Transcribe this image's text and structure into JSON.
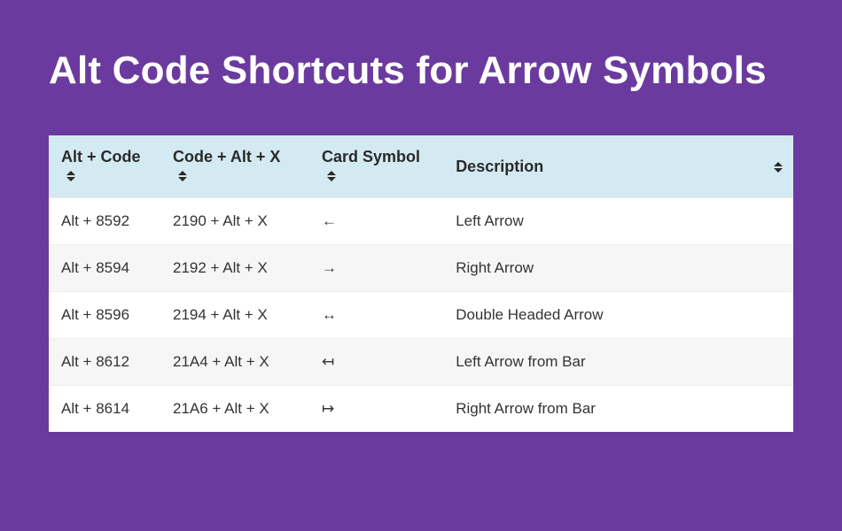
{
  "title": "Alt Code Shortcuts for Arrow Symbols",
  "columns": {
    "alt_code": "Alt + Code",
    "hex_code": "Code + Alt + X",
    "symbol": "Card Symbol",
    "description": "Description"
  },
  "rows": [
    {
      "alt_code": "Alt + 8592",
      "hex_code": "2190 + Alt + X",
      "symbol": "←",
      "description": "Left Arrow"
    },
    {
      "alt_code": "Alt + 8594",
      "hex_code": "2192 + Alt + X",
      "symbol": "→",
      "description": "Right Arrow"
    },
    {
      "alt_code": "Alt + 8596",
      "hex_code": "2194 + Alt + X",
      "symbol": "↔",
      "description": "Double Headed Arrow"
    },
    {
      "alt_code": "Alt + 8612",
      "hex_code": "21A4 + Alt + X",
      "symbol": "↤",
      "description": "Left Arrow from Bar"
    },
    {
      "alt_code": "Alt + 8614",
      "hex_code": "21A6 + Alt + X",
      "symbol": "↦",
      "description": "Right Arrow from Bar"
    }
  ]
}
